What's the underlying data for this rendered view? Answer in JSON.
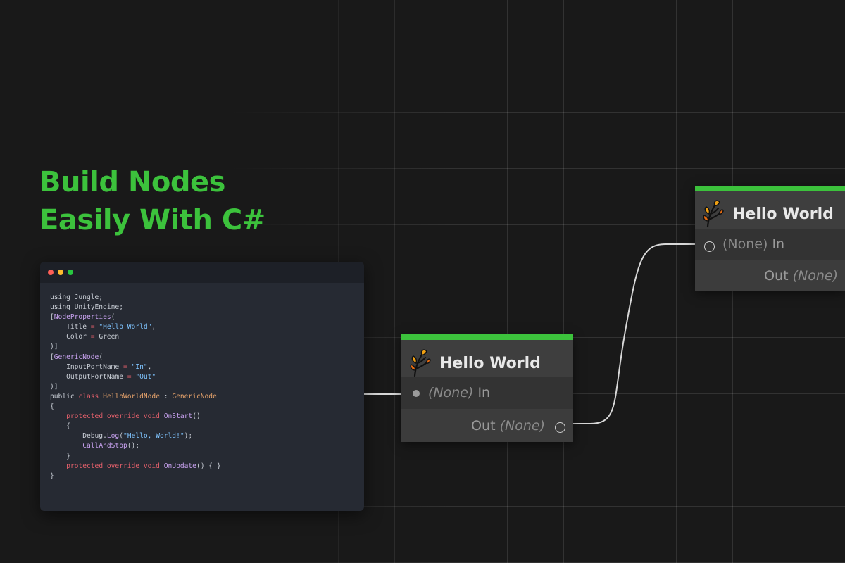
{
  "headline": {
    "line1": "Build Nodes",
    "line2": "Easily With C#"
  },
  "colors": {
    "accent": "#3cc23c",
    "background": "#191919",
    "node_body": "#393939",
    "wire": "#d8d8d8"
  },
  "code_window": {
    "lines": [
      [
        {
          "t": "using Jungle;"
        }
      ],
      [
        {
          "t": "using UnityEngine;"
        }
      ],
      [
        {
          "t": "["
        },
        {
          "t": "NodeProperties",
          "c": "attr"
        },
        {
          "t": "("
        }
      ],
      [
        {
          "t": "    Title "
        },
        {
          "t": "=",
          "c": "kw"
        },
        {
          "t": " "
        },
        {
          "t": "\"Hello World\"",
          "c": "str"
        },
        {
          "t": ","
        }
      ],
      [
        {
          "t": "    Color "
        },
        {
          "t": "=",
          "c": "kw"
        },
        {
          "t": " Green"
        }
      ],
      [
        {
          "t": ")]"
        }
      ],
      [
        {
          "t": "["
        },
        {
          "t": "GenericNode",
          "c": "attr"
        },
        {
          "t": "("
        }
      ],
      [
        {
          "t": "    InputPortName "
        },
        {
          "t": "=",
          "c": "kw"
        },
        {
          "t": " "
        },
        {
          "t": "\"In\"",
          "c": "str"
        },
        {
          "t": ","
        }
      ],
      [
        {
          "t": "    OutputPortName "
        },
        {
          "t": "=",
          "c": "kw"
        },
        {
          "t": " "
        },
        {
          "t": "\"Out\"",
          "c": "str"
        }
      ],
      [
        {
          "t": ")]"
        }
      ],
      [
        {
          "t": "public "
        },
        {
          "t": "class",
          "c": "kw"
        },
        {
          "t": " "
        },
        {
          "t": "HelloWorldNode",
          "c": "ty"
        },
        {
          "t": " : "
        },
        {
          "t": "GenericNode",
          "c": "ty"
        }
      ],
      [
        {
          "t": "{"
        }
      ],
      [
        {
          "t": "    "
        },
        {
          "t": "protected override void",
          "c": "kw"
        },
        {
          "t": " "
        },
        {
          "t": "OnStart",
          "c": "fn"
        },
        {
          "t": "()"
        }
      ],
      [
        {
          "t": "    {"
        }
      ],
      [
        {
          "t": "        Debug."
        },
        {
          "t": "Log",
          "c": "fn"
        },
        {
          "t": "("
        },
        {
          "t": "\"Hello, World!\"",
          "c": "str"
        },
        {
          "t": ");"
        }
      ],
      [
        {
          "t": "        "
        },
        {
          "t": "CallAndStop",
          "c": "fn"
        },
        {
          "t": "();"
        }
      ],
      [
        {
          "t": "    }"
        }
      ],
      [
        {
          "t": "    "
        },
        {
          "t": "protected override void",
          "c": "kw"
        },
        {
          "t": " "
        },
        {
          "t": "OnUpdate",
          "c": "fn"
        },
        {
          "t": "() { }"
        }
      ],
      [
        {
          "t": "}"
        }
      ]
    ]
  },
  "nodes": [
    {
      "title": "Hello World",
      "icon": "leaf-icon",
      "input": {
        "type": "(None)",
        "label": "In",
        "port_icon": "filled-port-icon"
      },
      "output": {
        "label": "Out",
        "type": "(None)",
        "port_icon": "open-port-icon"
      }
    },
    {
      "title": "Hello World",
      "icon": "leaf-icon",
      "input": {
        "type": "(None)",
        "label": "In",
        "port_icon": "open-port-icon"
      },
      "output": {
        "label": "Out",
        "type": "(None)"
      }
    }
  ]
}
